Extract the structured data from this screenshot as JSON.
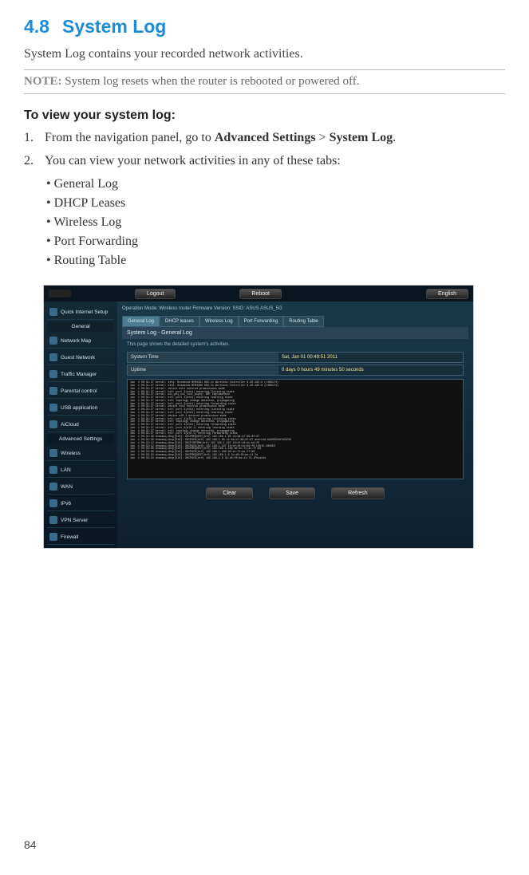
{
  "page_number": "84",
  "section": {
    "number": "4.8",
    "title": "System Log"
  },
  "intro": "System Log contains your recorded network activities.",
  "note": {
    "label": "NOTE:",
    "text": " System log resets when the router is rebooted or powered off."
  },
  "howto_heading": "To view your system log:",
  "steps": {
    "s1": {
      "num": "1.",
      "pre": "From the navigation panel, go to ",
      "bold1": "Advanced Settings",
      "sep": " > ",
      "bold2": "System Log",
      "post": "."
    },
    "s2": {
      "num": "2.",
      "text": "You can view your network activities in any of these tabs:"
    }
  },
  "tab_list": [
    "General Log",
    "DHCP Leases",
    "Wireless Log",
    "Port Forwarding",
    "Routing Table"
  ],
  "router_ui": {
    "topbar": {
      "logout": "Logout",
      "reboot": "Reboot",
      "lang": "English"
    },
    "ops_row": "Operation Mode: Wireless router   Firmware Version:     SSID: ASUS  ASUS_5G",
    "tabs": [
      "General Log",
      "DHCP leases",
      "Wireless Log",
      "Port Forwarding",
      "Routing Table"
    ],
    "panel_title": "System Log - General Log",
    "panel_sub": "This page shows the detailed system's activities.",
    "system_time": {
      "k": "System Time",
      "v": "Sat, Jan 01  00:49:51  2011"
    },
    "uptime": {
      "k": "Uptime",
      "v": "0 days 0 hours 49 minutes 50 seconds"
    },
    "sidebar": {
      "qis": "Quick Internet Setup",
      "general": "General",
      "items1": [
        "Network Map",
        "Guest Network",
        "Traffic Manager",
        "Parental control",
        "USB application",
        "AiCloud"
      ],
      "adv": "Advanced Settings",
      "items2": [
        "Wireless",
        "LAN",
        "WAN",
        "IPv6",
        "VPN Server",
        "Firewall"
      ]
    },
    "buttons": {
      "clear": "Clear",
      "save": "Save",
      "refresh": "Refresh"
    },
    "log_lines": [
      "Jan  1 00:31:27 kernel: eth1: Broadcom BCM4331 802.11 Wireless Controller 6.30.102.9 (r366174)",
      "Jan  1 00:31:27 kernel: eth2: Broadcom BCM4360 802.11 Wireless Controller 6.30.102.9 (r366174)",
      "Jan  1 00:31:27 kernel: device eth1 entered promiscuous mode",
      "Jan  1 00:31:27 kernel: br0: port 2(eth1) entering listening state",
      "Jan  1 00:31:27 kernel: wlc_phy_cal_init_acphy: NOT Implemented",
      "Jan  1 00:31:27 kernel: br0: port 2(eth1) entering learning state",
      "Jan  1 00:31:27 kernel: br0: topology change detected, propagating",
      "Jan  1 00:31:27 kernel: br0: port 2(eth1) entering forwarding state",
      "Jan  1 00:31:27 kernel: device eth2 entered promiscuous mode",
      "Jan  1 00:31:27 kernel: br0: port 3(eth2) entering listening state",
      "Jan  1 00:31:27 kernel: br0: port 3(eth2) entering learning state",
      "Jan  1 00:31:27 kernel: device wl0.1 entered promiscuous mode",
      "Jan  1 00:31:27 kernel: br0: port 4(wl0.1) entering listening state",
      "Jan  1 00:31:27 kernel: br0: topology change detected, propagating",
      "Jan  1 00:31:27 kernel: br0: port 3(eth2) entering forwarding state",
      "Jan  1 00:31:27 kernel: br0: port 4(wl0.1) entering learning state",
      "Jan  1 00:31:27 kernel: br0: topology change detected, propagating",
      "Jan  1 00:31:27 kernel: br0: port 4(wl0.1) entering forwarding state",
      "Jan  1 00:31:39 dnsmasq-dhcp[510]: DHCPREQUEST(br0) 192.168.1.60 c4:6a:b7:89:8f:97",
      "Jan  1 00:31:39 dnsmasq-dhcp[510]: DHCPACK(br0) 192.168.1.60 c4:6a:b7:89:8f:97 android-b9d0832df434239",
      "Jan  1 00:32:12 dnsmasq-dhcp[510]: DHCPINFORM(br0) 192.168.1.197 10:bf:48:4c:b9:f0",
      "Jan  1 00:32:12 dnsmasq-dhcp[510]: DHCPACK(br0) 192.168.1.197 10:bf:48:4c:b9:f0 LOUIE-CHAVEZ",
      "Jan  1 00:33:08 dnsmasq-dhcp[510]: DHCPREQUEST(br0) 192.168.1.189 b0:ec:71:ac:f7:96",
      "Jan  1 00:33:08 dnsmasq-dhcp[510]: DHCPACK(br0) 192.168.1.189 b0:ec:71:ac:f7:96",
      "Jan  1 00:33:34 dnsmasq-dhcp[510]: DHCPREQUEST(br0) 192.168.1.9 3c:d0:f8:be:11:7d",
      "Jan  1 00:33:34 dnsmasq-dhcp[510]: DHCPACK(br0) 192.168.1.9 3c:d0:f8:be:11:7d iPhone4s"
    ]
  }
}
